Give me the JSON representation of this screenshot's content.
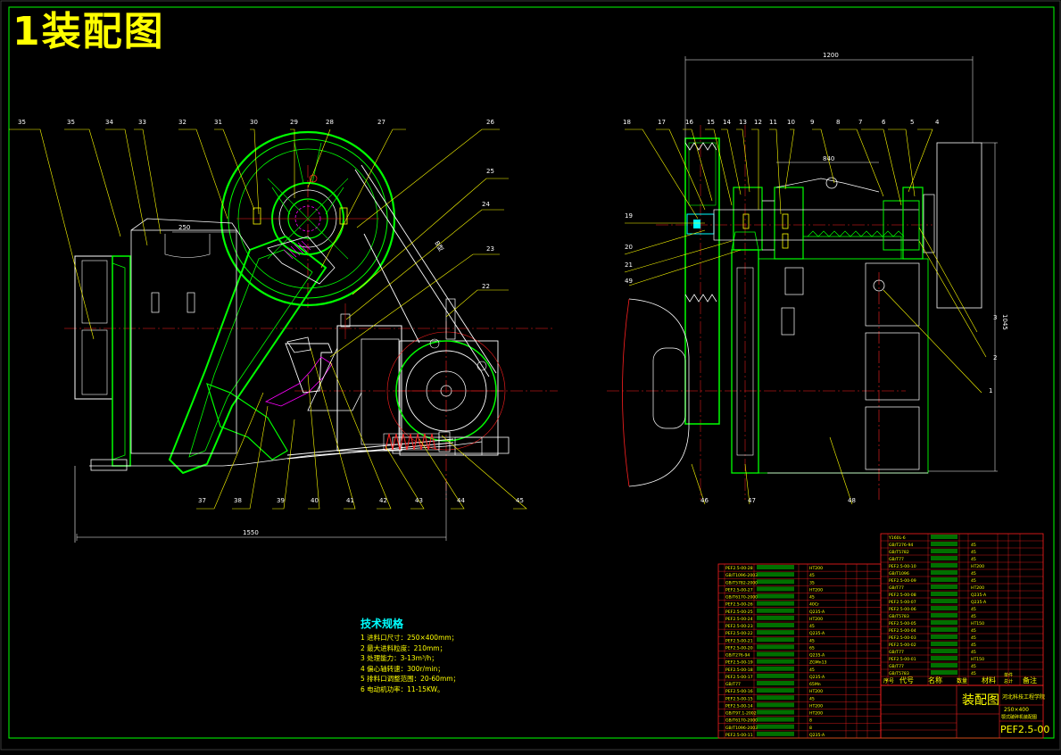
{
  "title": "1装配图",
  "dims": {
    "width_left": "1550",
    "width_right": "1200",
    "height_right": "1045",
    "sub_840": "840",
    "sub_250": "250",
    "belt_label": "B型"
  },
  "callouts_left_top": [
    "35",
    "35",
    "34",
    "33",
    "32",
    "31",
    "30",
    "29",
    "28",
    "27",
    "26",
    "25",
    "24",
    "23",
    "22"
  ],
  "callouts_left_bottom": [
    "37",
    "38",
    "39",
    "40",
    "41",
    "42",
    "43",
    "44",
    "45"
  ],
  "callouts_right_top": [
    "18",
    "17",
    "16",
    "15",
    "14",
    "13",
    "12",
    "11",
    "10",
    "9",
    "8",
    "7",
    "6",
    "5",
    "4"
  ],
  "callouts_right_left": [
    "19",
    "20",
    "21",
    "49"
  ],
  "callouts_right_side": [
    "3",
    "2",
    "1"
  ],
  "callouts_right_bottom": [
    "46",
    "47",
    "48"
  ],
  "tech_spec": {
    "heading": "技术规格",
    "lines": [
      "1 进料口尺寸：250×400mm；",
      "2 最大进料粒度：210mm；",
      "3 处理能力：3-13m³/h；",
      "4 偏心轴转速：300r/min；",
      "5 排料口调整范围：20-60mm；",
      "6 电动机功率：11-15KW。"
    ]
  },
  "title_block": {
    "headers": [
      "序号",
      "代号",
      "名称",
      "数量",
      "材料",
      "单件",
      "总计",
      "备注"
    ],
    "drawing_name": "装配图",
    "school": "河北科技工程学院",
    "product": "250×400",
    "product_sub": "颚式破碎机装配图",
    "drawing_number": "PEF2.5-00"
  },
  "bom_left_codes": [
    "PEF2.5-00-28",
    "GB/T1096-2003",
    "GB/T5782-2000",
    "PEF2.5-00-27",
    "GB/T6170-2000",
    "PEF2.5-00-26",
    "PEF2.5-00-25",
    "PEF2.5-00-24",
    "PEF2.5-00-23",
    "PEF2.5-00-22",
    "PEF2.5-00-21",
    "PEF2.5-00-20",
    "GB/T276-94",
    "PEF2.5-00-19",
    "PEF2.5-00-18",
    "PEF2.5-00-17",
    "GB/T77",
    "PEF2.5-00-16",
    "PEF2.5-00-15",
    "PEF2.5-00-14",
    "GB/T97.1-2002",
    "GB/T6170-2000",
    "GB/T1096-2003",
    "PEF2.5-00-11"
  ],
  "bom_left_mats": [
    "HT200",
    "45",
    "35",
    "HT200",
    "45",
    "40Cr",
    "Q235-A",
    "HT200",
    "45",
    "Q235-A",
    "45",
    "65",
    "Q235-A",
    "ZGMn13",
    "45",
    "Q235-A",
    "65Mn",
    "HT200",
    "45",
    "HT200",
    "HT200",
    "8",
    "8",
    "Q235-A"
  ],
  "bom_right_codes": [
    "Y160L-6",
    "GB/T276-94",
    "GB/T5782",
    "GB/T77",
    "PEF2.5-00-10",
    "GB/T1096",
    "PEF2.5-00-09",
    "GB/T77",
    "PEF2.5-00-08",
    "PEF2.5-00-07",
    "PEF2.5-00-06",
    "GB/T5783",
    "PEF2.5-00-05",
    "PEF2.5-00-04",
    "PEF2.5-00-03",
    "PEF2.5-00-02",
    "GB/T77",
    "PEF2.5-00-01",
    "GB/T77",
    "GB/T5783"
  ],
  "bom_right_mats": [
    "",
    "45",
    "45",
    "45",
    "HT200",
    "45",
    "45",
    "HT200",
    "Q235-A",
    "Q235-A",
    "45",
    "45",
    "HT150",
    "45",
    "45",
    "45",
    "45",
    "HT150",
    "45",
    "45"
  ]
}
